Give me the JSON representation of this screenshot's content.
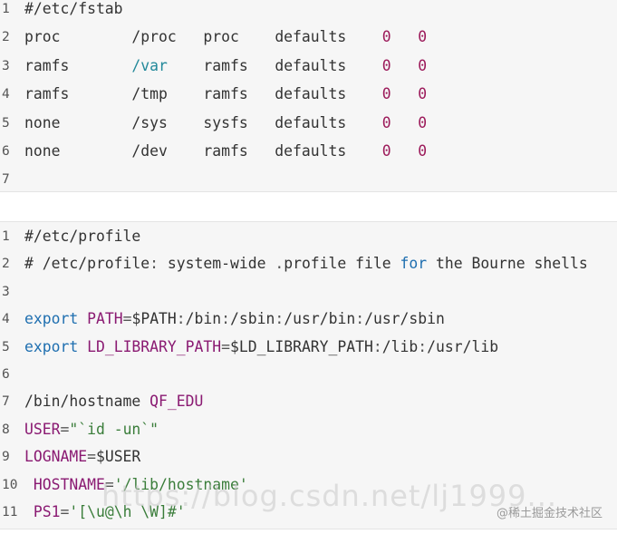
{
  "block1": {
    "lines": [
      {
        "num": "1",
        "tokens": [
          {
            "t": "#/etc/fstab",
            "c": ""
          }
        ]
      },
      {
        "num": "2",
        "tokens": [
          {
            "t": "proc",
            "c": ""
          },
          {
            "t": "        /proc   ",
            "c": ""
          },
          {
            "t": "proc    defaults    ",
            "c": ""
          },
          {
            "t": "0",
            "c": "pink"
          },
          {
            "t": "   ",
            "c": ""
          },
          {
            "t": "0",
            "c": "pink"
          }
        ]
      },
      {
        "num": "3",
        "tokens": [
          {
            "t": "ramfs       ",
            "c": ""
          },
          {
            "t": "/var",
            "c": "teal"
          },
          {
            "t": "    ramfs   defaults    ",
            "c": ""
          },
          {
            "t": "0",
            "c": "pink"
          },
          {
            "t": "   ",
            "c": ""
          },
          {
            "t": "0",
            "c": "pink"
          }
        ]
      },
      {
        "num": "4",
        "tokens": [
          {
            "t": "ramfs       /tmp    ramfs   defaults    ",
            "c": ""
          },
          {
            "t": "0",
            "c": "pink"
          },
          {
            "t": "   ",
            "c": ""
          },
          {
            "t": "0",
            "c": "pink"
          }
        ]
      },
      {
        "num": "5",
        "tokens": [
          {
            "t": "none        /sys    sysfs   defaults    ",
            "c": ""
          },
          {
            "t": "0",
            "c": "pink"
          },
          {
            "t": "   ",
            "c": ""
          },
          {
            "t": "0",
            "c": "pink"
          }
        ]
      },
      {
        "num": "6",
        "tokens": [
          {
            "t": "none        /dev    ramfs   defaults    ",
            "c": ""
          },
          {
            "t": "0",
            "c": "pink"
          },
          {
            "t": "   ",
            "c": ""
          },
          {
            "t": "0",
            "c": "pink"
          }
        ]
      },
      {
        "num": "7",
        "tokens": []
      }
    ]
  },
  "block2": {
    "lines": [
      {
        "num": "1",
        "tokens": [
          {
            "t": "#/etc/profile",
            "c": ""
          }
        ]
      },
      {
        "num": "2",
        "tokens": [
          {
            "t": "# /etc/profile",
            "c": ""
          },
          {
            "t": ":",
            "c": "punc"
          },
          {
            "t": " system-wide ",
            "c": ""
          },
          {
            "t": ".",
            "c": "punc"
          },
          {
            "t": "profile file ",
            "c": ""
          },
          {
            "t": "for",
            "c": "blue"
          },
          {
            "t": " the Bourne shells",
            "c": ""
          }
        ]
      },
      {
        "num": "3",
        "tokens": []
      },
      {
        "num": "4",
        "tokens": [
          {
            "t": "export",
            "c": "blue"
          },
          {
            "t": " ",
            "c": ""
          },
          {
            "t": "PATH",
            "c": "purple"
          },
          {
            "t": "=",
            "c": "punc"
          },
          {
            "t": "$PATH",
            "c": ""
          },
          {
            "t": ":",
            "c": "punc"
          },
          {
            "t": "/bin",
            "c": ""
          },
          {
            "t": ":",
            "c": "punc"
          },
          {
            "t": "/sbin",
            "c": ""
          },
          {
            "t": ":",
            "c": "punc"
          },
          {
            "t": "/usr/bin",
            "c": ""
          },
          {
            "t": ":",
            "c": "punc"
          },
          {
            "t": "/usr/sbin",
            "c": ""
          }
        ]
      },
      {
        "num": "5",
        "tokens": [
          {
            "t": "export",
            "c": "blue"
          },
          {
            "t": " ",
            "c": ""
          },
          {
            "t": "LD_LIBRARY_PATH",
            "c": "purple"
          },
          {
            "t": "=",
            "c": "punc"
          },
          {
            "t": "$LD_LIBRARY_PATH",
            "c": ""
          },
          {
            "t": ":",
            "c": "punc"
          },
          {
            "t": "/lib",
            "c": ""
          },
          {
            "t": ":",
            "c": "punc"
          },
          {
            "t": "/usr/lib",
            "c": ""
          }
        ]
      },
      {
        "num": "6",
        "tokens": []
      },
      {
        "num": "7",
        "tokens": [
          {
            "t": "/bin/hostname ",
            "c": ""
          },
          {
            "t": "QF_EDU",
            "c": "purple"
          }
        ]
      },
      {
        "num": "8",
        "tokens": [
          {
            "t": "USER",
            "c": "purple"
          },
          {
            "t": "=",
            "c": "punc"
          },
          {
            "t": "\"`id -un`\"",
            "c": "green"
          }
        ]
      },
      {
        "num": "9",
        "tokens": [
          {
            "t": "LOGNAME",
            "c": "purple"
          },
          {
            "t": "=",
            "c": "punc"
          },
          {
            "t": "$USER",
            "c": ""
          }
        ]
      },
      {
        "num": "10",
        "tokens": [
          {
            "t": " ",
            "c": ""
          },
          {
            "t": "HOSTNAME",
            "c": "purple"
          },
          {
            "t": "=",
            "c": "punc"
          },
          {
            "t": "'/lib/hostname'",
            "c": "green"
          }
        ]
      },
      {
        "num": "11",
        "tokens": [
          {
            "t": " ",
            "c": ""
          },
          {
            "t": "PS1",
            "c": "purple"
          },
          {
            "t": "=",
            "c": "punc"
          },
          {
            "t": "'[\\u@\\h \\W]#'",
            "c": "green"
          }
        ]
      }
    ]
  },
  "watermark": "https://blog.csdn.net/lj1999...",
  "badge": "@稀土掘金技术社区"
}
